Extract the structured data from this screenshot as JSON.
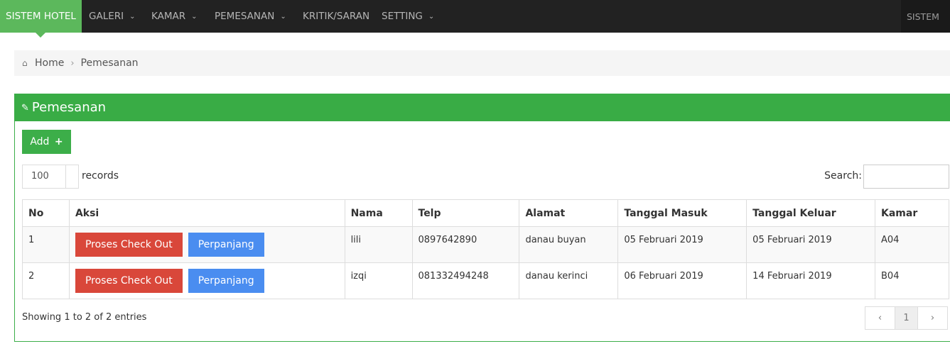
{
  "navbar": {
    "brand": "SISTEM HOTEL",
    "items": [
      {
        "label": "GALERI",
        "chevron": "chevron-down-icon"
      },
      {
        "label": "KAMAR",
        "chevron": "chevron-down-icon"
      },
      {
        "label": "PEMESANAN",
        "chevron": "chevron-down-icon"
      },
      {
        "label": "KRITIK/SARAN"
      },
      {
        "label": "SETTING",
        "chevron": "chevron-down-icon"
      }
    ],
    "right_label": "SISTEM"
  },
  "breadcrumb": {
    "home": "Home",
    "current": "Pemesanan"
  },
  "panel": {
    "title": "Pemesanan",
    "add_label": "Add",
    "records_value": "100",
    "records_label": "records",
    "search_label": "Search:",
    "search_value": ""
  },
  "table": {
    "headers": [
      "No",
      "Aksi",
      "Nama",
      "Telp",
      "Alamat",
      "Tanggal Masuk",
      "Tanggal Keluar",
      "Kamar"
    ],
    "rows": [
      {
        "no": "1",
        "checkout_label": "Proses Check Out",
        "extend_label": "Perpanjang",
        "nama": "lili",
        "telp": "0897642890",
        "alamat": "danau buyan",
        "masuk": "05 Februari 2019",
        "keluar": "05 Februari 2019",
        "kamar": "A04"
      },
      {
        "no": "2",
        "checkout_label": "Proses Check Out",
        "extend_label": "Perpanjang",
        "nama": "izqi",
        "telp": "081332494248",
        "alamat": "danau kerinci",
        "masuk": "06 Februari 2019",
        "keluar": "14 Februari 2019",
        "kamar": "B04"
      }
    ]
  },
  "footer": {
    "info": "Showing 1 to 2 of 2 entries",
    "page": "1"
  },
  "colors": {
    "brand": "#5cb85c",
    "panel_header": "#39ac45",
    "danger": "#d9473a",
    "primary": "#4a8df0"
  }
}
